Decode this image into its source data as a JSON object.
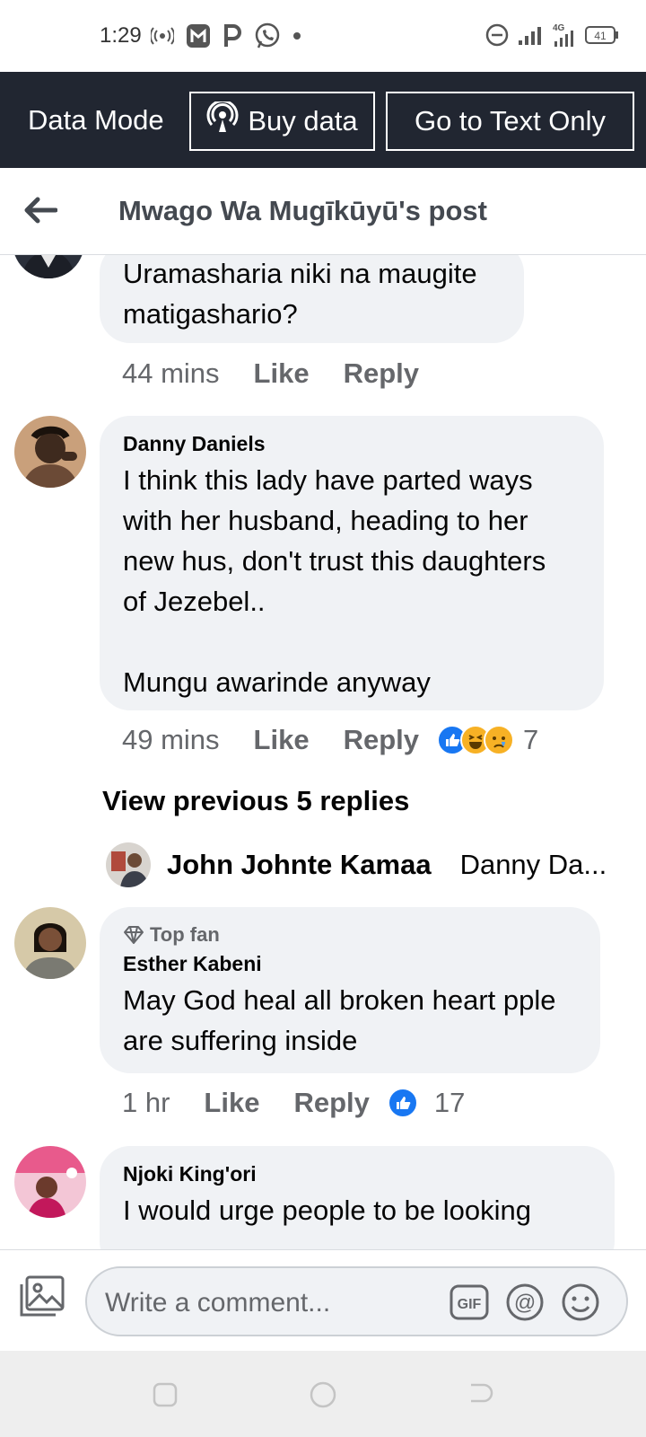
{
  "status_bar": {
    "time": "1:29",
    "battery": "41",
    "network": "4G"
  },
  "data_bar": {
    "mode_label": "Data Mode",
    "buy_label": "Buy data",
    "text_only_label": "Go to Text Only"
  },
  "header": {
    "title": "Mwago Wa Mugīkūyū's post"
  },
  "comments": [
    {
      "text": "Uramasharia niki na maugite\nmatigashario?",
      "time": "44 mins",
      "like": "Like",
      "reply": "Reply"
    },
    {
      "author": "Danny Daniels",
      "text": "I think this lady have parted ways\nwith her husband, heading to her\nnew hus, don't trust this daughters\nof Jezebel..\n\nMungu awarinde anyway",
      "time": "49 mins",
      "like": "Like",
      "reply": "Reply",
      "reaction_count": "7"
    },
    {
      "badge": "Top fan",
      "author": "Esther Kabeni",
      "text": "May God heal all broken heart pple\nare suffering inside",
      "time": "1 hr",
      "like": "Like",
      "reply": "Reply",
      "reaction_count": "17"
    },
    {
      "author": "Njoki King'ori",
      "text": "I would urge people to be looking"
    }
  ],
  "view_previous": "View previous 5 replies",
  "reply_preview": {
    "name": "John Johnte Kamaa",
    "snippet": "Danny Da..."
  },
  "composer": {
    "placeholder": "Write a comment..."
  },
  "colors": {
    "accent": "#1877f2",
    "header_bar": "#212631",
    "bubble": "#f0f2f5"
  }
}
